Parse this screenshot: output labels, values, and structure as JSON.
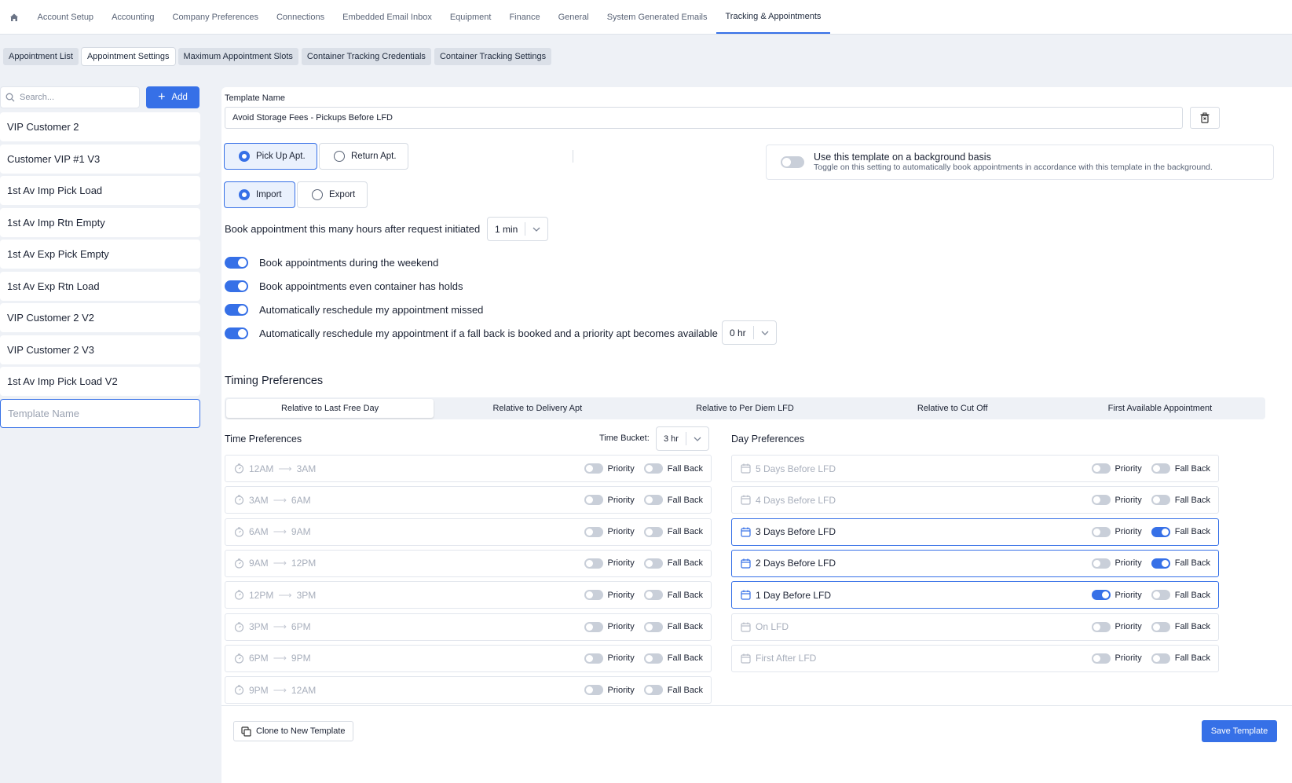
{
  "topnav": {
    "tabs": [
      "Account Setup",
      "Accounting",
      "Company Preferences",
      "Connections",
      "Embedded Email Inbox",
      "Equipment",
      "Finance",
      "General",
      "System Generated Emails",
      "Tracking & Appointments"
    ],
    "active": "Tracking & Appointments"
  },
  "subtabs": {
    "tabs": [
      "Appointment List",
      "Appointment Settings",
      "Maximum Appointment Slots",
      "Container Tracking Credentials",
      "Container Tracking Settings"
    ],
    "active": "Appointment Settings"
  },
  "sidebar": {
    "search_placeholder": "Search...",
    "add_label": "Add",
    "items": [
      "VIP Customer 2",
      "Customer VIP #1 V3",
      "1st Av Imp Pick Load",
      "1st Av Imp Rtn Empty",
      "1st Av Exp Pick Empty",
      "1st Av Exp Rtn Load",
      "VIP Customer 2 V2",
      "VIP Customer 2 V3",
      "1st Av Imp Pick Load V2"
    ],
    "new_template_placeholder": "Template Name"
  },
  "form": {
    "template_name_label": "Template Name",
    "template_name_value": "Avoid Storage Fees - Pickups Before LFD",
    "apt_type": {
      "options": [
        "Pick Up Apt.",
        "Return Apt."
      ],
      "selected": "Pick Up Apt."
    },
    "direction": {
      "options": [
        "Import",
        "Export"
      ],
      "selected": "Import"
    },
    "background": {
      "enabled": false,
      "title": "Use this template on a background basis",
      "subtitle": "Toggle on this setting to automatically book appointments in accordance with this template in the background."
    },
    "book_hours_label": "Book appointment this many hours after request initiated",
    "book_hours_value": "1 min",
    "toggles": [
      {
        "label": "Book appointments during the weekend",
        "on": true
      },
      {
        "label": "Book appointments even container has holds",
        "on": true
      },
      {
        "label": "Automatically reschedule my appointment missed",
        "on": true
      },
      {
        "label": "Automatically reschedule my appointment if a fall back is booked and a priority apt becomes available",
        "on": true
      }
    ],
    "reschedule_value": "0 hr"
  },
  "timing": {
    "title": "Timing Preferences",
    "tabs": [
      "Relative to Last Free Day",
      "Relative to Delivery Apt",
      "Relative to Per Diem LFD",
      "Relative to Cut Off",
      "First Available Appointment"
    ],
    "active_tab": "Relative to Last Free Day",
    "time_title": "Time Preferences",
    "time_bucket_label": "Time Bucket:",
    "time_bucket_value": "3 hr",
    "priority_label": "Priority",
    "fallback_label": "Fall Back",
    "time_rows": [
      {
        "from": "12AM",
        "to": "3AM",
        "priority": false,
        "fallback": false
      },
      {
        "from": "3AM",
        "to": "6AM",
        "priority": false,
        "fallback": false
      },
      {
        "from": "6AM",
        "to": "9AM",
        "priority": false,
        "fallback": false
      },
      {
        "from": "9AM",
        "to": "12PM",
        "priority": false,
        "fallback": false
      },
      {
        "from": "12PM",
        "to": "3PM",
        "priority": false,
        "fallback": false
      },
      {
        "from": "3PM",
        "to": "6PM",
        "priority": false,
        "fallback": false
      },
      {
        "from": "6PM",
        "to": "9PM",
        "priority": false,
        "fallback": false
      },
      {
        "from": "9PM",
        "to": "12AM",
        "priority": false,
        "fallback": false
      }
    ],
    "day_title": "Day Preferences",
    "day_rows": [
      {
        "label": "5 Days Before LFD",
        "priority": false,
        "fallback": false
      },
      {
        "label": "4 Days Before LFD",
        "priority": false,
        "fallback": false
      },
      {
        "label": "3 Days Before LFD",
        "priority": false,
        "fallback": true
      },
      {
        "label": "2 Days Before LFD",
        "priority": false,
        "fallback": true
      },
      {
        "label": "1 Day Before LFD",
        "priority": true,
        "fallback": false
      },
      {
        "label": "On LFD",
        "priority": false,
        "fallback": false
      },
      {
        "label": "First After LFD",
        "priority": false,
        "fallback": false
      }
    ]
  },
  "footer": {
    "clone_label": "Clone to New Template",
    "save_label": "Save Template"
  },
  "colors": {
    "accent": "#3670e7",
    "muted": "#a8afbc",
    "bg": "#eef1f6"
  }
}
